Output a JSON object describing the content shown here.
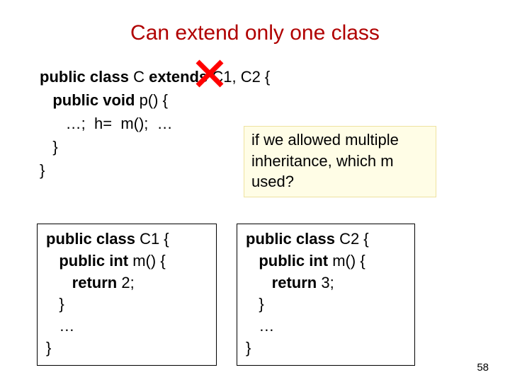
{
  "title": "Can extend only one class",
  "main_code": {
    "l1a": "public class",
    "l1b": " C ",
    "l1c": "extends",
    "l1d": " C1, C2 {",
    "l2a": "   public void",
    "l2b": " p() {",
    "l3": "      …;  h=  m();  …",
    "l4": "   }",
    "l5": "}"
  },
  "callout": {
    "l1": "if we allowed multiple",
    "l2": "inheritance, which m",
    "l3": "used?"
  },
  "c1": {
    "l1a": "public class",
    "l1b": " C1 {",
    "l2a": "   public int",
    "l2b": " m() {",
    "l3a": "      return",
    "l3b": " 2;",
    "l4": "   }",
    "l5": "   …",
    "l6": "}"
  },
  "c2": {
    "l1a": "public class",
    "l1b": " C2 {",
    "l2a": "   public int",
    "l2b": " m() {",
    "l3a": "      return",
    "l3b": " 3;",
    "l4": "   }",
    "l5": "   …",
    "l6": "}"
  },
  "page_number": "58"
}
